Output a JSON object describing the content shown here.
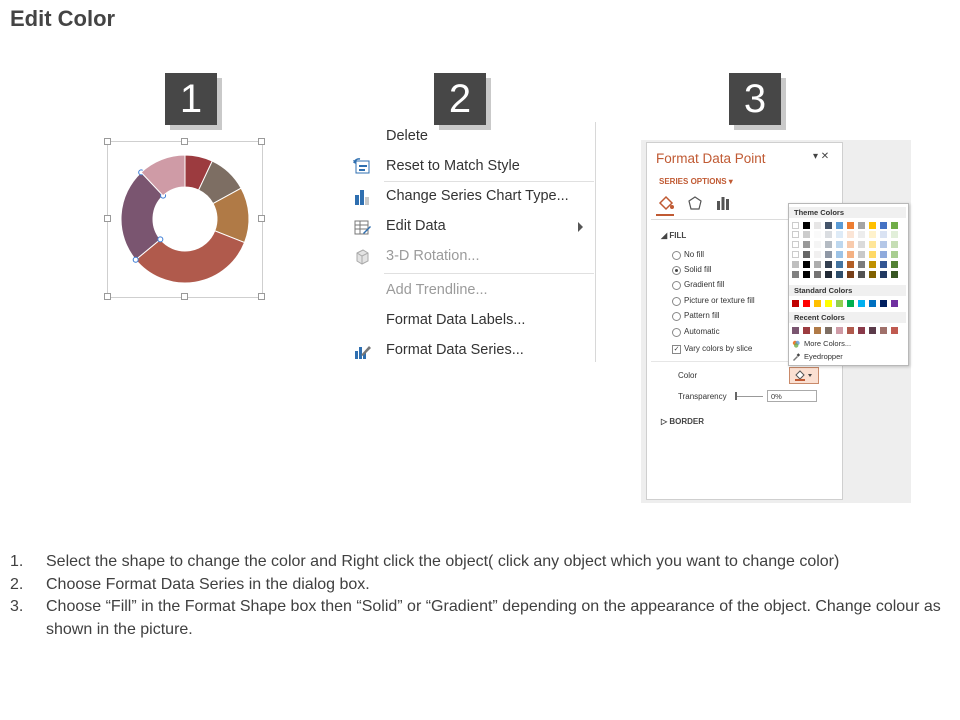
{
  "page": {
    "title": "Edit Color"
  },
  "steps_badges": [
    "1",
    "2",
    "3"
  ],
  "donut": {
    "segments": [
      {
        "color": "#9c3b3f",
        "value": 7
      },
      {
        "color": "#7d6e63",
        "value": 10
      },
      {
        "color": "#b07a46",
        "value": 14
      },
      {
        "color": "#b05a4c",
        "value": 33
      },
      {
        "color": "#7a5570",
        "value": 24
      },
      {
        "color": "#cf9ba6",
        "value": 12
      }
    ]
  },
  "context_menu": {
    "items": [
      {
        "label": "Delete",
        "icon": "none-icon",
        "disabled": false
      },
      {
        "label": "Reset to Match Style",
        "icon": "reset-style-icon",
        "disabled": false
      },
      {
        "label": "Change Series Chart Type...",
        "icon": "bar-chart-icon",
        "disabled": false
      },
      {
        "label": "Edit Data",
        "icon": "edit-data-icon",
        "disabled": false,
        "submenu": true
      },
      {
        "label": "3-D Rotation...",
        "icon": "cube-icon",
        "disabled": true
      },
      {
        "label": "Add Trendline...",
        "icon": "none-icon",
        "disabled": true
      },
      {
        "label": "Format Data Labels...",
        "icon": "none-icon",
        "disabled": false
      },
      {
        "label": "Format Data Series...",
        "icon": "format-series-icon",
        "disabled": false
      }
    ]
  },
  "format_pane": {
    "title": "Format Data Point",
    "controls": "▾ ✕",
    "series_options": "SERIES OPTIONS ▾",
    "fill_header": "FILL",
    "fill_options": [
      "No fill",
      "Solid fill",
      "Gradient fill",
      "Picture or texture fill",
      "Pattern fill",
      "Automatic"
    ],
    "selected_fill": "Solid fill",
    "vary_colors": "Vary colors by slice",
    "color_label": "Color",
    "transparency_label": "Transparency",
    "transparency_value": "0%",
    "border_header": "BORDER"
  },
  "palette": {
    "theme_header": "Theme Colors",
    "standard_header": "Standard Colors",
    "recent_header": "Recent Colors",
    "more_colors": "More Colors...",
    "eyedropper": "Eyedropper",
    "theme_top": [
      "#ffffff",
      "#000000",
      "#e7e6e6",
      "#44546a",
      "#5b9bd5",
      "#ed7d31",
      "#a5a5a5",
      "#ffc000",
      "#4472c4",
      "#70ad47"
    ],
    "standard": [
      "#c00000",
      "#ff0000",
      "#ffc000",
      "#ffff00",
      "#92d050",
      "#00b050",
      "#00b0f0",
      "#0070c0",
      "#002060",
      "#7030a0"
    ],
    "recent": [
      "#7a5570",
      "#9c3b3f",
      "#b07a46",
      "#7d6e63",
      "#cf9ba6",
      "#b05a4c",
      "#8a3a4a",
      "#5b3b4a",
      "#a0706a",
      "#c05a50"
    ]
  },
  "instructions": [
    {
      "no": "1.",
      "text": "Select the shape to change the color and Right click the object( click any object which you want to change color)"
    },
    {
      "no": "2.",
      "text": "Choose Format Data Series in the dialog box."
    },
    {
      "no": "3.",
      "text": "Choose “Fill” in the Format Shape box then “Solid” or “Gradient” depending on the appearance of the object. Change colour as shown in the picture."
    }
  ]
}
